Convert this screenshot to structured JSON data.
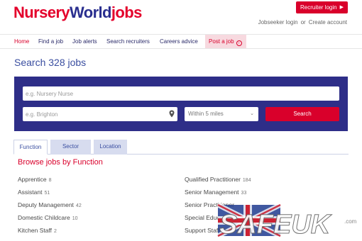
{
  "logo": {
    "part1": "Nursery",
    "part2": "World",
    "part3": "jobs"
  },
  "header": {
    "recruiter_label": "Recruiter login",
    "recruiter_arrow": "▶",
    "jobseeker_login": "Jobseeker login",
    "or": "or",
    "create_account": "Create account"
  },
  "nav": {
    "home": "Home",
    "find_job": "Find a job",
    "job_alerts": "Job alerts",
    "search_recruiters": "Search recruiters",
    "careers_advice": "Careers advice",
    "post_job": "Post a job"
  },
  "page_title": "Search 328 jobs",
  "search": {
    "keyword_placeholder": "e.g. Nursery Nurse",
    "location_placeholder": "e.g. Brighton",
    "distance": "Within 5 miles",
    "button": "Search"
  },
  "tabs": [
    "Function",
    "Sector",
    "Location"
  ],
  "browse_title": "Browse jobs by Function",
  "functions_left": [
    {
      "name": "Apprentice",
      "count": "8"
    },
    {
      "name": "Assistant",
      "count": "51"
    },
    {
      "name": "Deputy Management",
      "count": "42"
    },
    {
      "name": "Domestic Childcare",
      "count": "10"
    },
    {
      "name": "Kitchen Staff",
      "count": "2"
    }
  ],
  "functions_right": [
    {
      "name": "Qualified Practitioner",
      "count": "184"
    },
    {
      "name": "Senior Management",
      "count": "33"
    },
    {
      "name": "Senior Practitioner",
      "count": ""
    },
    {
      "name": "Special Educational",
      "count": ""
    },
    {
      "name": "Support Staff",
      "count": ""
    }
  ],
  "watermark": {
    "text": "SAFEUK",
    "suffix": ".com"
  },
  "colors": {
    "brand_red": "#d9002b",
    "brand_navy": "#2e2e88",
    "link_blue": "#3a4ea0"
  }
}
